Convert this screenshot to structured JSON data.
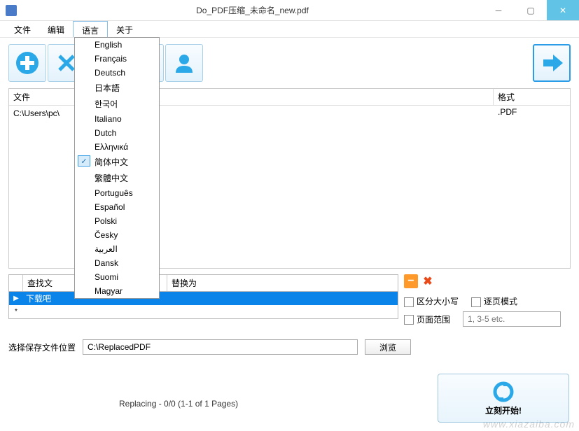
{
  "title": "Do_PDF压缩_未命名_new.pdf",
  "menubar": {
    "file": "文件",
    "edit": "编辑",
    "language": "语言",
    "about": "关于"
  },
  "languages": [
    "English",
    "Français",
    "Deutsch",
    "日本語",
    "한국어",
    "Italiano",
    "Dutch",
    "Ελληνικά",
    "简体中文",
    "繁體中文",
    "Português",
    "Español",
    "Polski",
    "Česky",
    "العربية",
    "Dansk",
    "Suomi",
    "Magyar"
  ],
  "language_checked_index": 8,
  "filelist": {
    "headers": {
      "file": "文件",
      "format": "格式"
    },
    "rows": [
      {
        "path": "C:\\Users\\pc\\               未命名_new.pdf",
        "format": ".PDF"
      }
    ]
  },
  "findtable": {
    "headers": {
      "find": "查找文",
      "replace": "替换为"
    },
    "rows": [
      {
        "marker": "▶",
        "find": "下载吧",
        "replace": ""
      },
      {
        "marker": "*",
        "find": "",
        "replace": ""
      }
    ]
  },
  "options": {
    "case_sensitive": "区分大小写",
    "page_mode": "逐页模式",
    "page_range": "页面范围",
    "range_placeholder": "1, 3-5 etc."
  },
  "save": {
    "label": "选择保存文件位置",
    "path": "C:\\ReplacedPDF",
    "browse": "浏览"
  },
  "status": "Replacing - 0/0 (1-1 of 1 Pages)",
  "start": "立刻开始!",
  "watermark": "www.xiazaiba.com"
}
